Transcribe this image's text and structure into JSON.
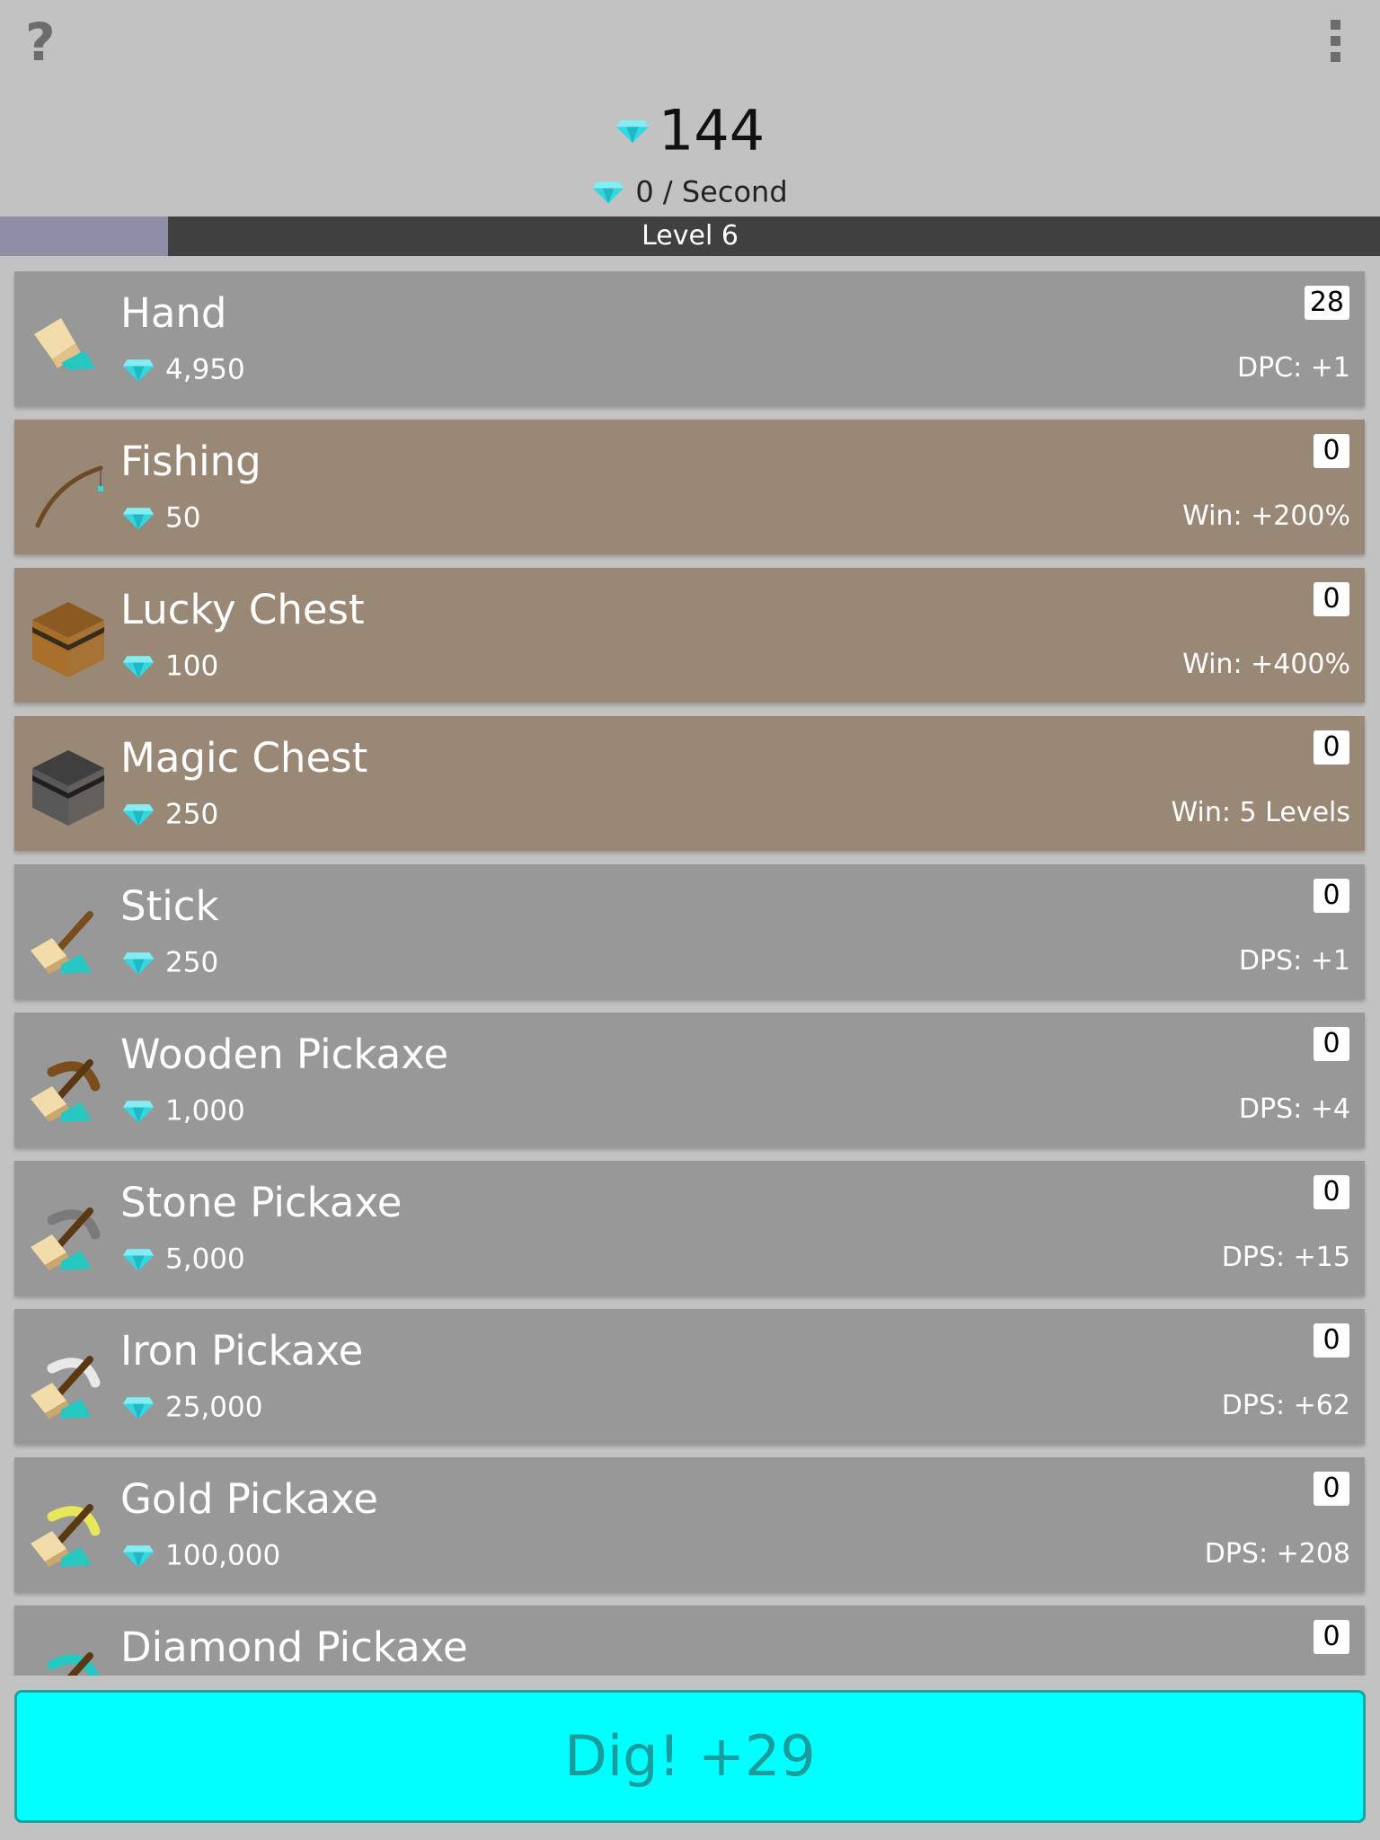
{
  "header": {
    "help_icon": "?",
    "menu_icon": "more-vert-icon",
    "total_gems": "144",
    "rate": "0 / Second",
    "gem_color": "#35d6e0"
  },
  "level": {
    "label": "Level 6",
    "progress": 0.122
  },
  "items": [
    {
      "name": "Hand",
      "cost": "4,950",
      "count": "28",
      "stat": "DPC: +1",
      "icon": "hand-icon",
      "special": false
    },
    {
      "name": "Fishing",
      "cost": "50",
      "count": "0",
      "stat": "Win: +200%",
      "icon": "fishing-rod-icon",
      "special": true
    },
    {
      "name": "Lucky Chest",
      "cost": "100",
      "count": "0",
      "stat": "Win: +400%",
      "icon": "lucky-chest-icon",
      "special": true
    },
    {
      "name": "Magic Chest",
      "cost": "250",
      "count": "0",
      "stat": "Win: 5 Levels",
      "icon": "magic-chest-icon",
      "special": true
    },
    {
      "name": "Stick",
      "cost": "250",
      "count": "0",
      "stat": "DPS: +1",
      "icon": "stick-icon",
      "special": false
    },
    {
      "name": "Wooden Pickaxe",
      "cost": "1,000",
      "count": "0",
      "stat": "DPS: +4",
      "icon": "wooden-pickaxe-icon",
      "special": false
    },
    {
      "name": "Stone Pickaxe",
      "cost": "5,000",
      "count": "0",
      "stat": "DPS: +15",
      "icon": "stone-pickaxe-icon",
      "special": false
    },
    {
      "name": "Iron Pickaxe",
      "cost": "25,000",
      "count": "0",
      "stat": "DPS: +62",
      "icon": "iron-pickaxe-icon",
      "special": false
    },
    {
      "name": "Gold Pickaxe",
      "cost": "100,000",
      "count": "0",
      "stat": "DPS: +208",
      "icon": "gold-pickaxe-icon",
      "special": false
    },
    {
      "name": "Diamond Pickaxe",
      "cost": "",
      "count": "0",
      "stat": "",
      "icon": "diamond-pickaxe-icon",
      "special": false
    }
  ],
  "dig_button": {
    "label": "Dig! +29"
  },
  "colors": {
    "background": "#c2c2c2",
    "item_normal": "#989898",
    "item_special": "#9a8877",
    "level_bar": "#404040",
    "level_fill": "#8e8fa6",
    "dig_button": "#00ffff",
    "dig_text": "#1a9c9c"
  }
}
